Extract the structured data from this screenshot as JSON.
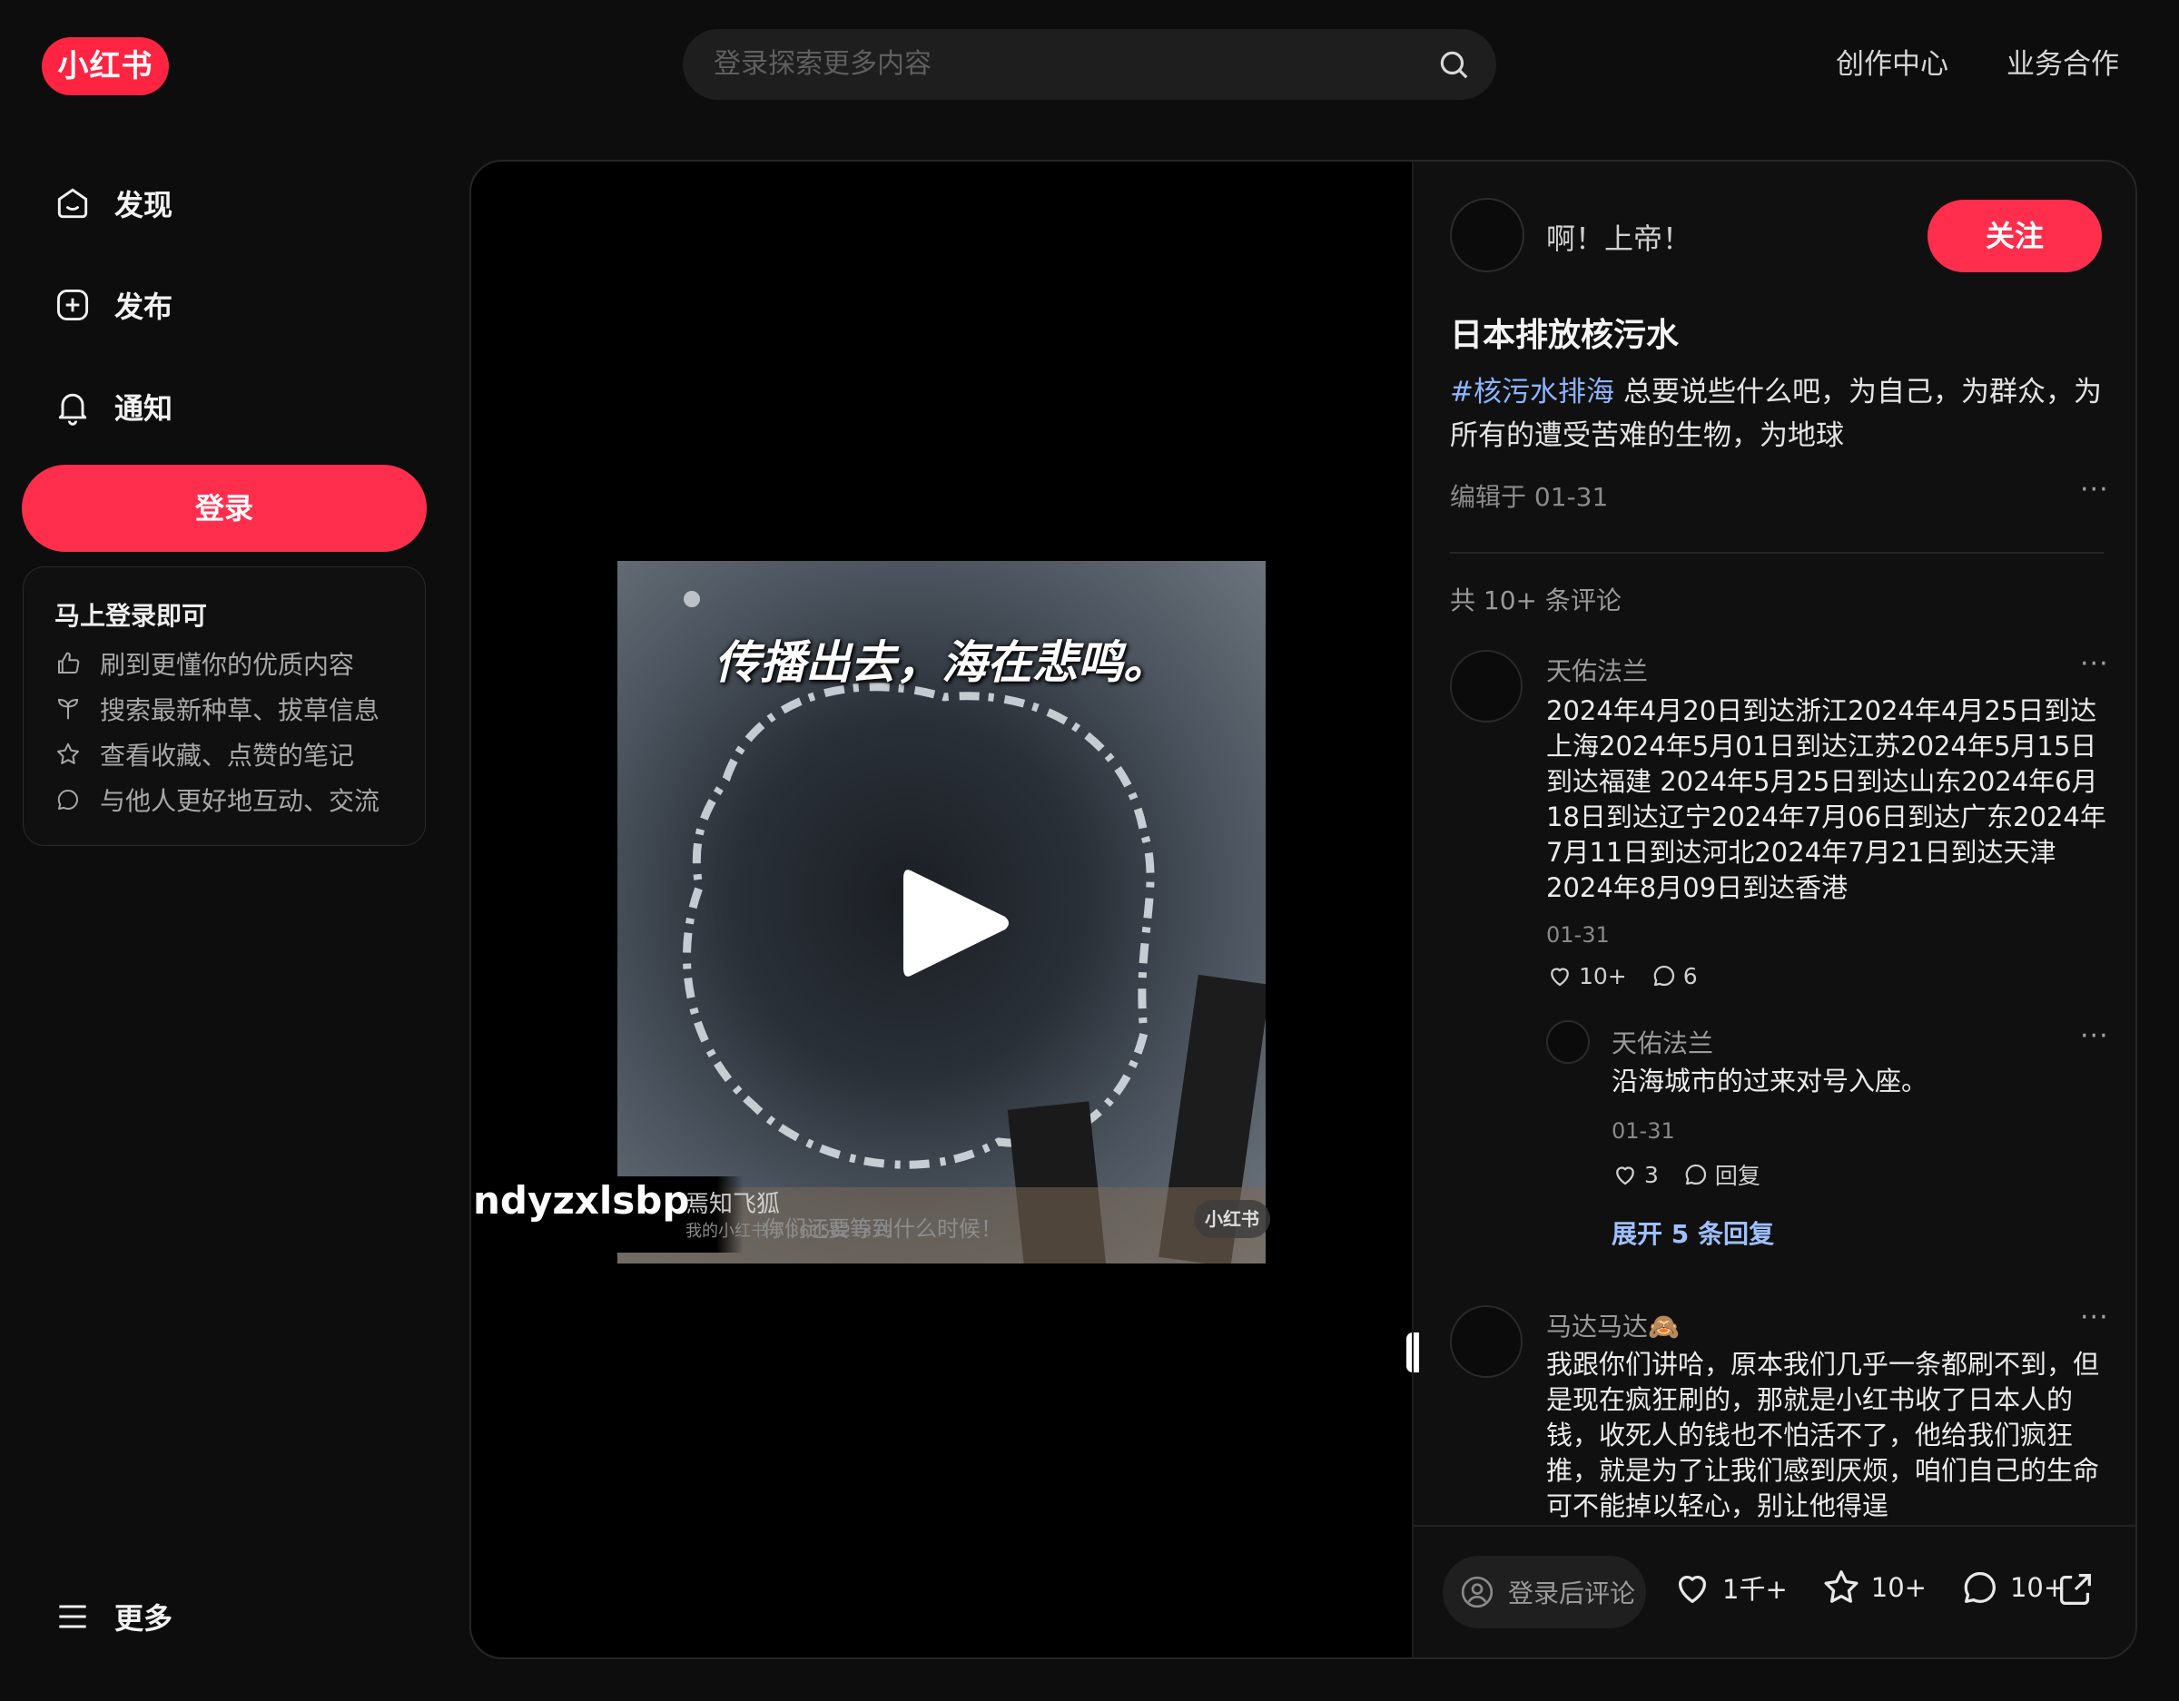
{
  "header": {
    "logo": "小红书",
    "search_placeholder": "登录探索更多内容",
    "links": [
      "创作中心",
      "业务合作"
    ]
  },
  "sidebar": {
    "items": [
      {
        "label": "发现",
        "icon": "home-icon"
      },
      {
        "label": "发布",
        "icon": "plus-square-icon"
      },
      {
        "label": "通知",
        "icon": "bell-icon"
      }
    ],
    "login_button": "登录",
    "login_card": {
      "title": "马上登录即可",
      "benefits": [
        {
          "label": "刷到更懂你的优质内容",
          "icon": "thumbs-up-icon"
        },
        {
          "label": "搜索最新种草、拔草信息",
          "icon": "sprout-icon"
        },
        {
          "label": "查看收藏、点赞的笔记",
          "icon": "star-icon"
        },
        {
          "label": "与他人更好地互动、交流",
          "icon": "chat-bubble-icon"
        }
      ]
    },
    "more": "更多"
  },
  "video": {
    "caption": "传播出去，海在悲鸣。",
    "watermark_user": "ndyzxlsbp",
    "watermark_channel": "焉知飞狐",
    "watermark_sub": "我的小红书号 3615821379",
    "overlay_text": "你们还要等到什么时候！",
    "watermark_logo": "小红书"
  },
  "note": {
    "author": "啊！上帝！",
    "follow": "关注",
    "title": "日本排放核污水",
    "tag": "#核污水排海",
    "description": "总要说些什么吧，为自己，为群众，为所有的遭受苦难的生物，为地球",
    "date": "编辑于 01-31",
    "more": "···"
  },
  "comments": {
    "count_label": "共 10+ 条评论",
    "items": [
      {
        "name": "天佑法兰",
        "text": "2024年4月20日到达浙江2024年4月25日到达上海2024年5月01日到达江苏2024年5月15日到达福建 2024年5月25日到达山东2024年6月18日到达辽宁2024年7月06日到达广东2024年7月11日到达河北2024年7月21日到达天津2024年8月09日到达香港",
        "date": "01-31",
        "likes": "10+",
        "replies": "6",
        "reply": {
          "name": "天佑法兰",
          "text": "沿海城市的过来对号入座。",
          "date": "01-31",
          "likes": "3",
          "reply_label": "回复"
        },
        "expand": "展开 5 条回复"
      },
      {
        "name": "马达马达🙈",
        "text": "我跟你们讲哈，原本我们几乎一条都刷不到，但是现在疯狂刷的，那就是小红书收了日本人的钱，收死人的钱也不怕活不了，他给我们疯狂推，就是为了让我们感到厌烦，咱们自己的生命可不能掉以轻心，别让他得逞"
      }
    ]
  },
  "bottom_bar": {
    "input_placeholder": "登录后评论",
    "likes": "1千+",
    "collects": "10+",
    "comments": "10+"
  },
  "colors": {
    "accent": "#ff2e4d",
    "link": "#8cb4ff",
    "background": "#0d0d0d"
  }
}
